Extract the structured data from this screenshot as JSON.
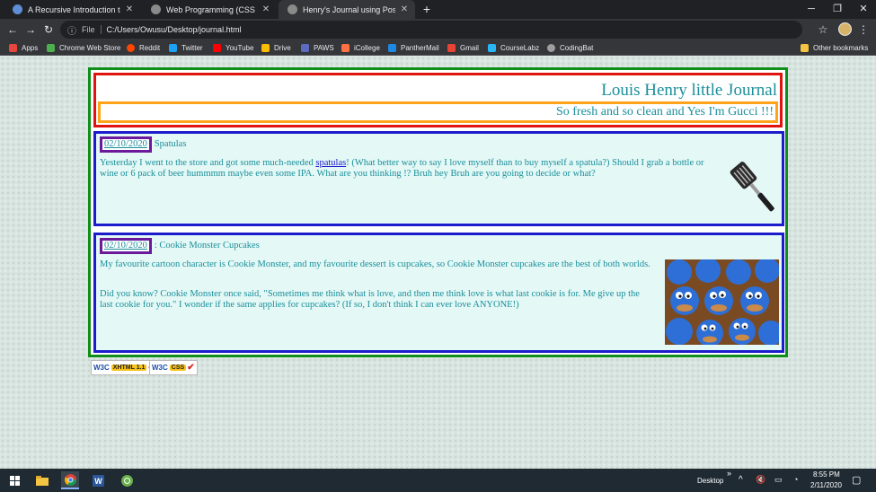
{
  "browser": {
    "tabs": [
      {
        "title": "A Recursive Introduction to the T",
        "favicon": "#5e8ed6"
      },
      {
        "title": "Web Programming (CSS Design",
        "favicon": "#8a8a8a"
      },
      {
        "title": "Henry's Journal using Positioning",
        "favicon": "#8a8a8a",
        "active": true
      }
    ],
    "address": {
      "scheme_label": "File",
      "url": "C:/Users/Owusu/Desktop/journal.html"
    },
    "bookmarks": [
      {
        "label": "Apps",
        "icon": "#e8453c"
      },
      {
        "label": "Chrome Web Store",
        "icon": "#4caf50"
      },
      {
        "label": "Reddit",
        "icon": "#ff4500"
      },
      {
        "label": "Twitter",
        "icon": "#1da1f2"
      },
      {
        "label": "YouTube",
        "icon": "#ff0000"
      },
      {
        "label": "Drive",
        "icon": "#fbbc04"
      },
      {
        "label": "PAWS",
        "icon": "#5c6bc0"
      },
      {
        "label": "iCollege",
        "icon": "#ff7043"
      },
      {
        "label": "PantherMail",
        "icon": "#1e88e5"
      },
      {
        "label": "Gmail",
        "icon": "#ea4335"
      },
      {
        "label": "CourseLabz",
        "icon": "#29b6f6"
      },
      {
        "label": "CodingBat",
        "icon": "#9e9e9e"
      }
    ],
    "other_bookmarks": "Other bookmarks"
  },
  "journal": {
    "title": "Louis Henry little Journal",
    "subtitle": "So fresh and so clean and Yes I'm Gucci !!!",
    "entries": [
      {
        "date": "02/10/2020",
        "heading": "Spatulas",
        "text_before_link": "Yesterday I went to the store and got some much-needed ",
        "link": "spatulas",
        "text_after_link": "! (What better way to say I love myself than to buy myself a spatula?) Should I grab a bottle or wine or 6 pack of beer hummmm maybe even some IPA. What are you thinking !? Bruh hey Bruh are you going to decide or what?"
      },
      {
        "date": "02/10/2020",
        "heading": ": Cookie Monster Cupcakes",
        "paragraph1": "My favourite cartoon character is Cookie Monster, and my favourite dessert is cupcakes, so Cookie Monster cupcakes are the best of both worlds.",
        "paragraph2": "Did you know? Cookie Monster once said, \"Sometimes me think what is love, and then me think love is what last cookie is for. Me give up the last cookie for you.\" I wonder if the same applies for cupcakes? (If so, I don't think I can ever love ANYONE!)"
      }
    ],
    "badges": [
      {
        "w3c": "W3C",
        "tag": "XHTML 1.1"
      },
      {
        "w3c": "W3C",
        "tag": "CSS"
      }
    ]
  },
  "taskbar": {
    "desktop_label": "Desktop",
    "time": "8:55 PM",
    "date": "2/11/2020"
  }
}
